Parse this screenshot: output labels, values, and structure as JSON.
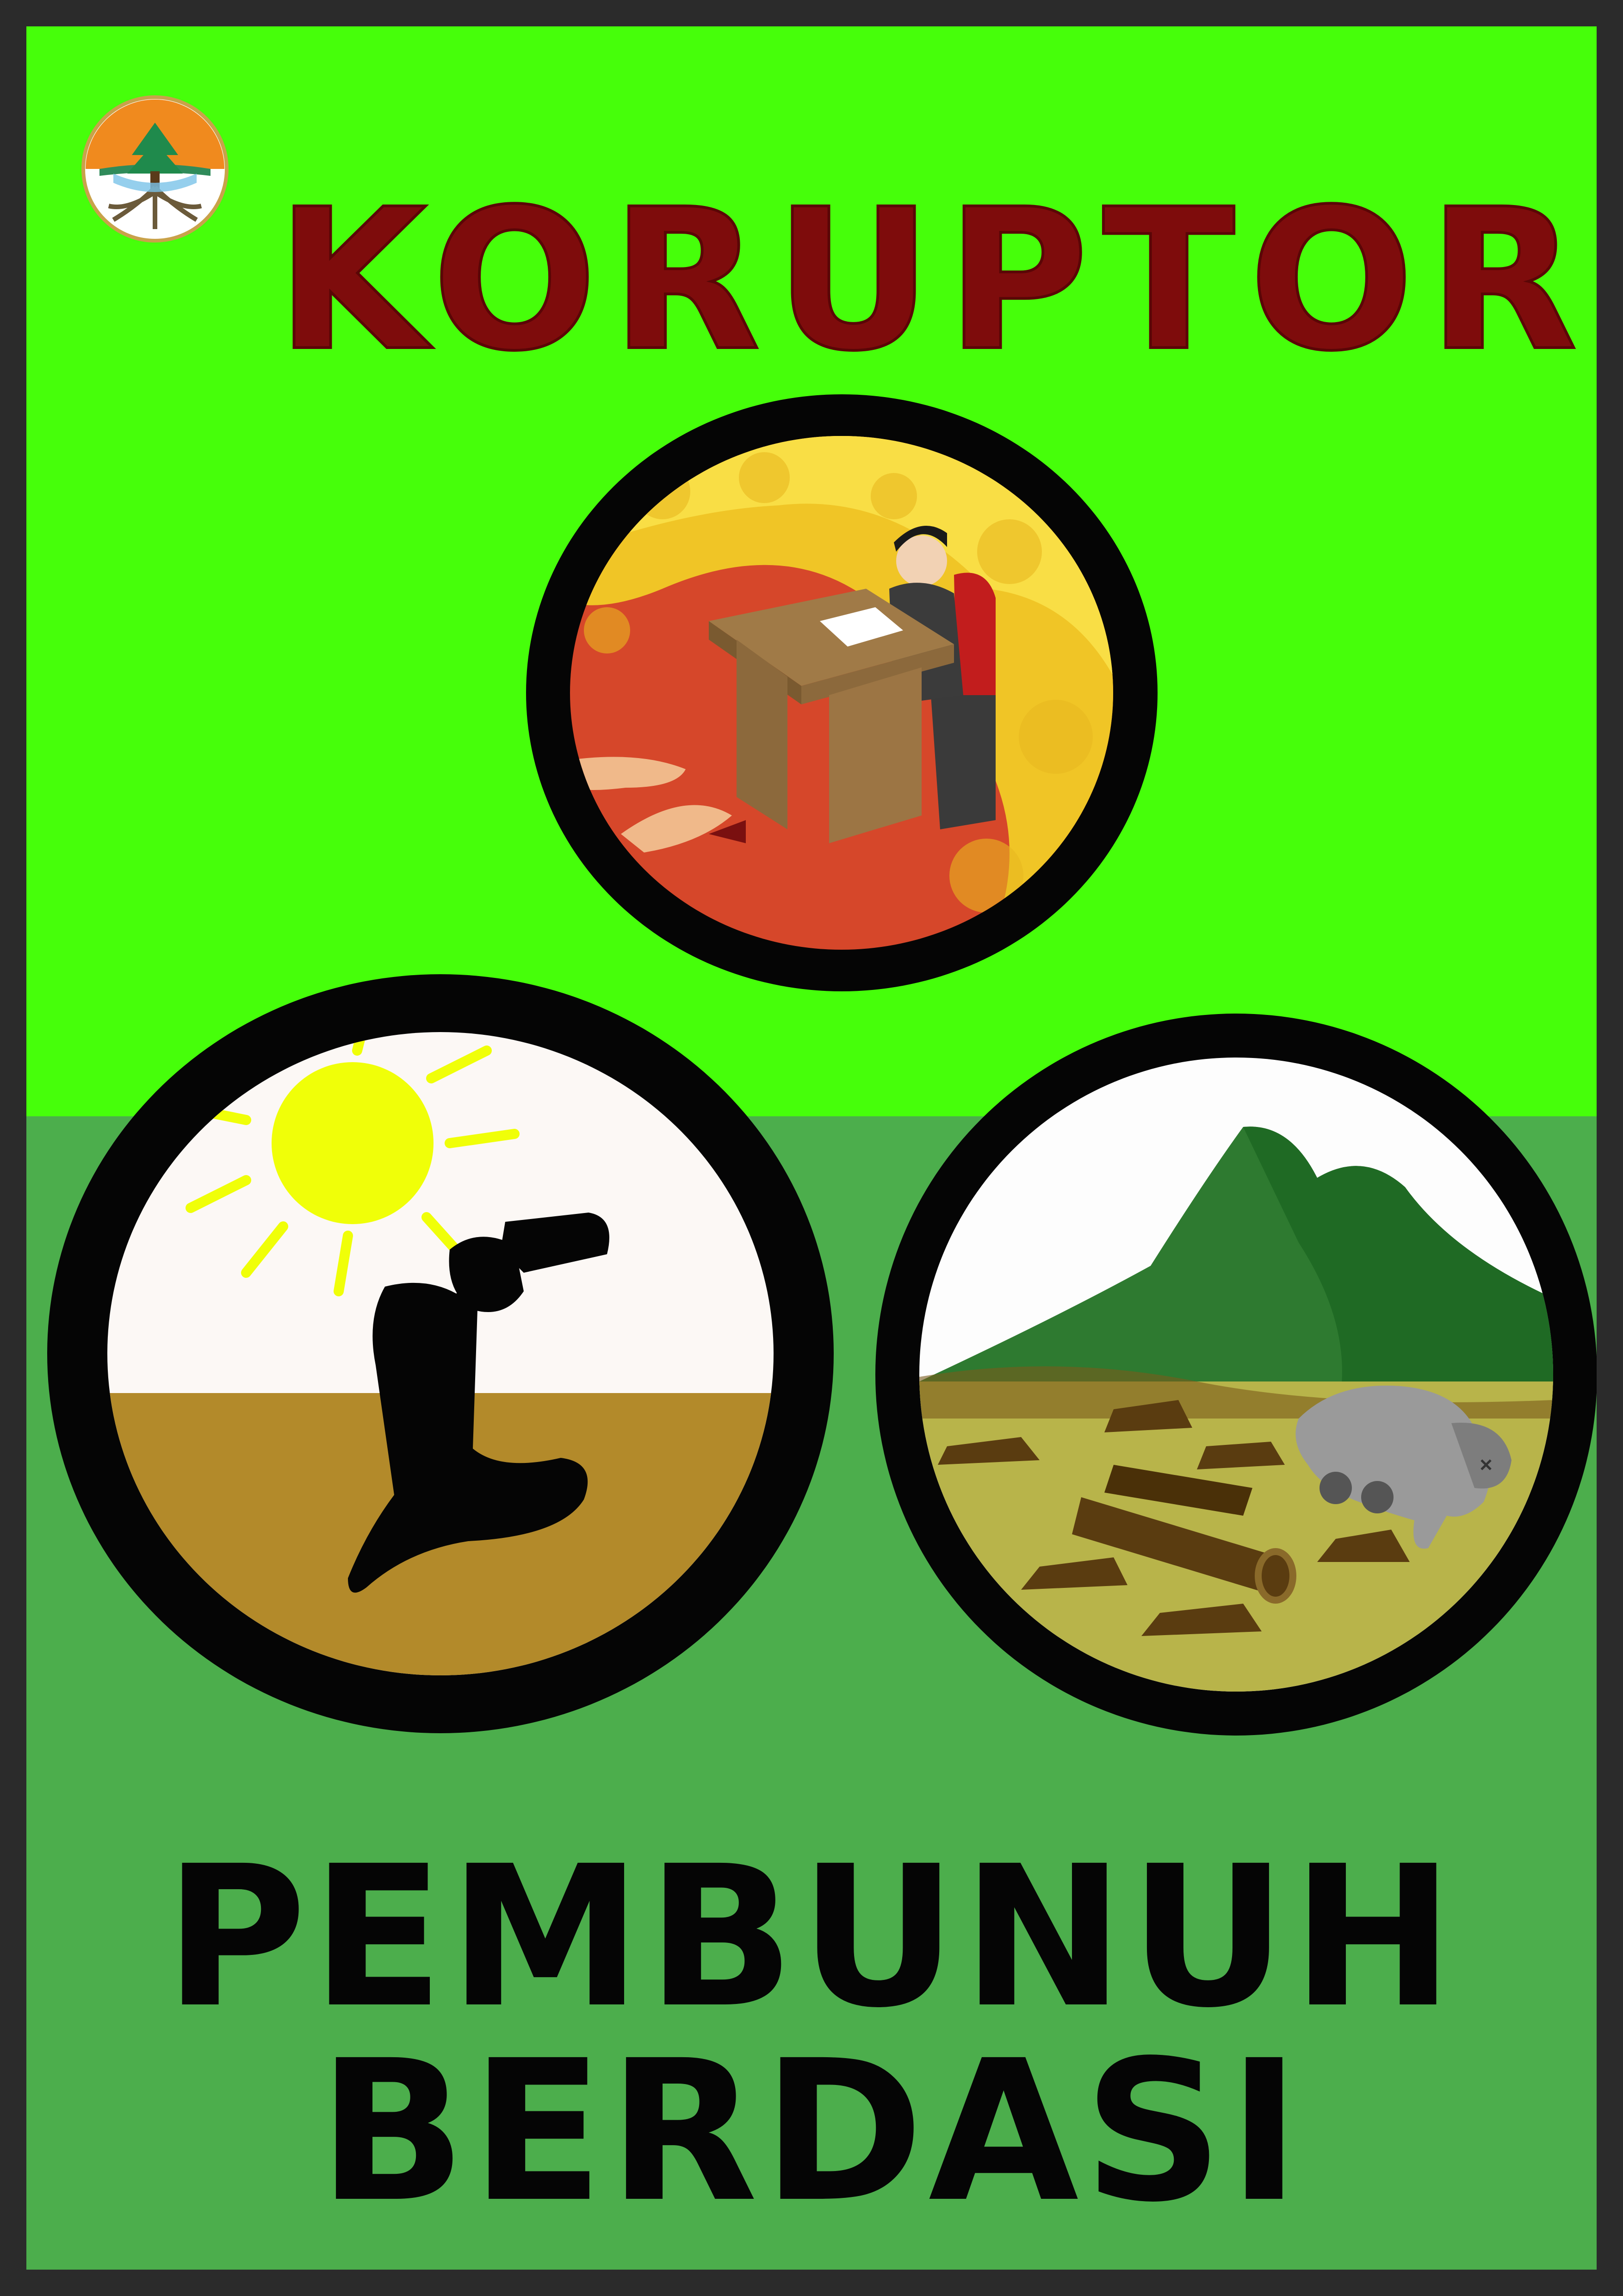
{
  "title": "KORUPTOR",
  "slogan": {
    "line1": "PEMBUNUH",
    "line2": "BERDASI"
  },
  "colors": {
    "top_background": "#46ff0a",
    "bottom_background": "#4cae4c",
    "border": "#2b2b2b",
    "title": "#7e0c0c",
    "slogan": "#050505"
  },
  "icons": [
    "ministry-emblem",
    "corrupt-official-illustration",
    "drought-thirst-illustration",
    "deforestation-illustration"
  ]
}
